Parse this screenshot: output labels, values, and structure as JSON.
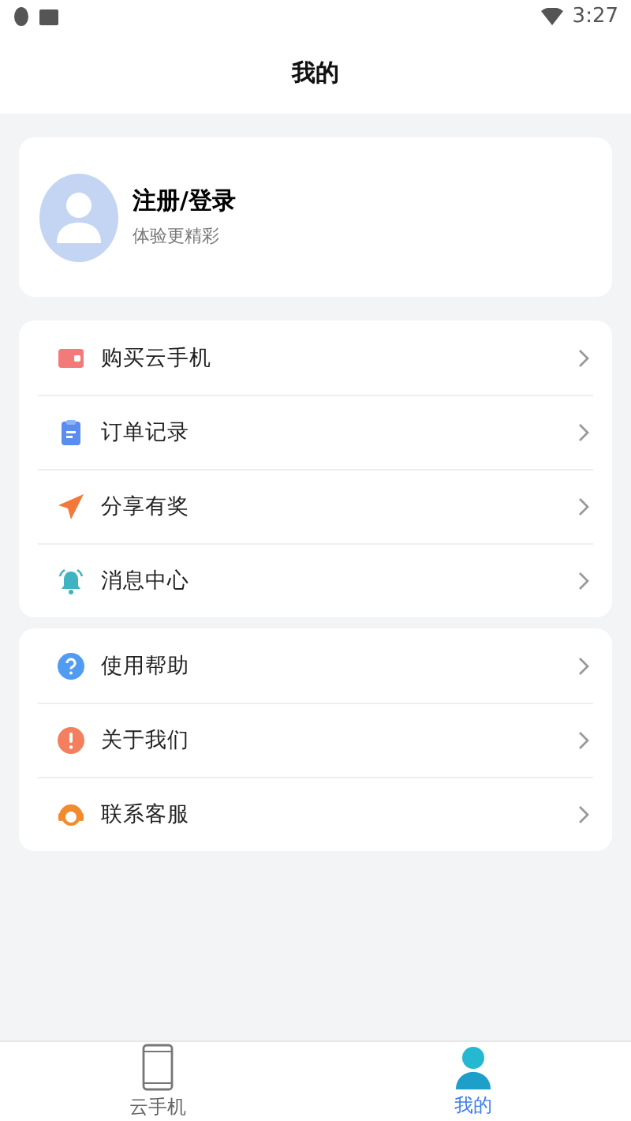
{
  "status_bar": {
    "time": "3:27"
  },
  "header": {
    "title": "我的"
  },
  "profile": {
    "name": "注册/登录",
    "subtitle": "体验更精彩"
  },
  "menu_groups": [
    {
      "items": [
        {
          "kind": "wallet",
          "label": "购买云手机"
        },
        {
          "kind": "clipboard",
          "label": "订单记录"
        },
        {
          "kind": "plane",
          "label": "分享有奖"
        },
        {
          "kind": "bell",
          "label": "消息中心"
        }
      ]
    },
    {
      "items": [
        {
          "kind": "help",
          "label": "使用帮助"
        },
        {
          "kind": "info",
          "label": "关于我们"
        },
        {
          "kind": "headset",
          "label": "联系客服"
        }
      ]
    }
  ],
  "tab_bar": [
    {
      "kind": "phone",
      "label": "云手机",
      "selected": false
    },
    {
      "kind": "person",
      "label": "我的",
      "selected": true
    }
  ]
}
